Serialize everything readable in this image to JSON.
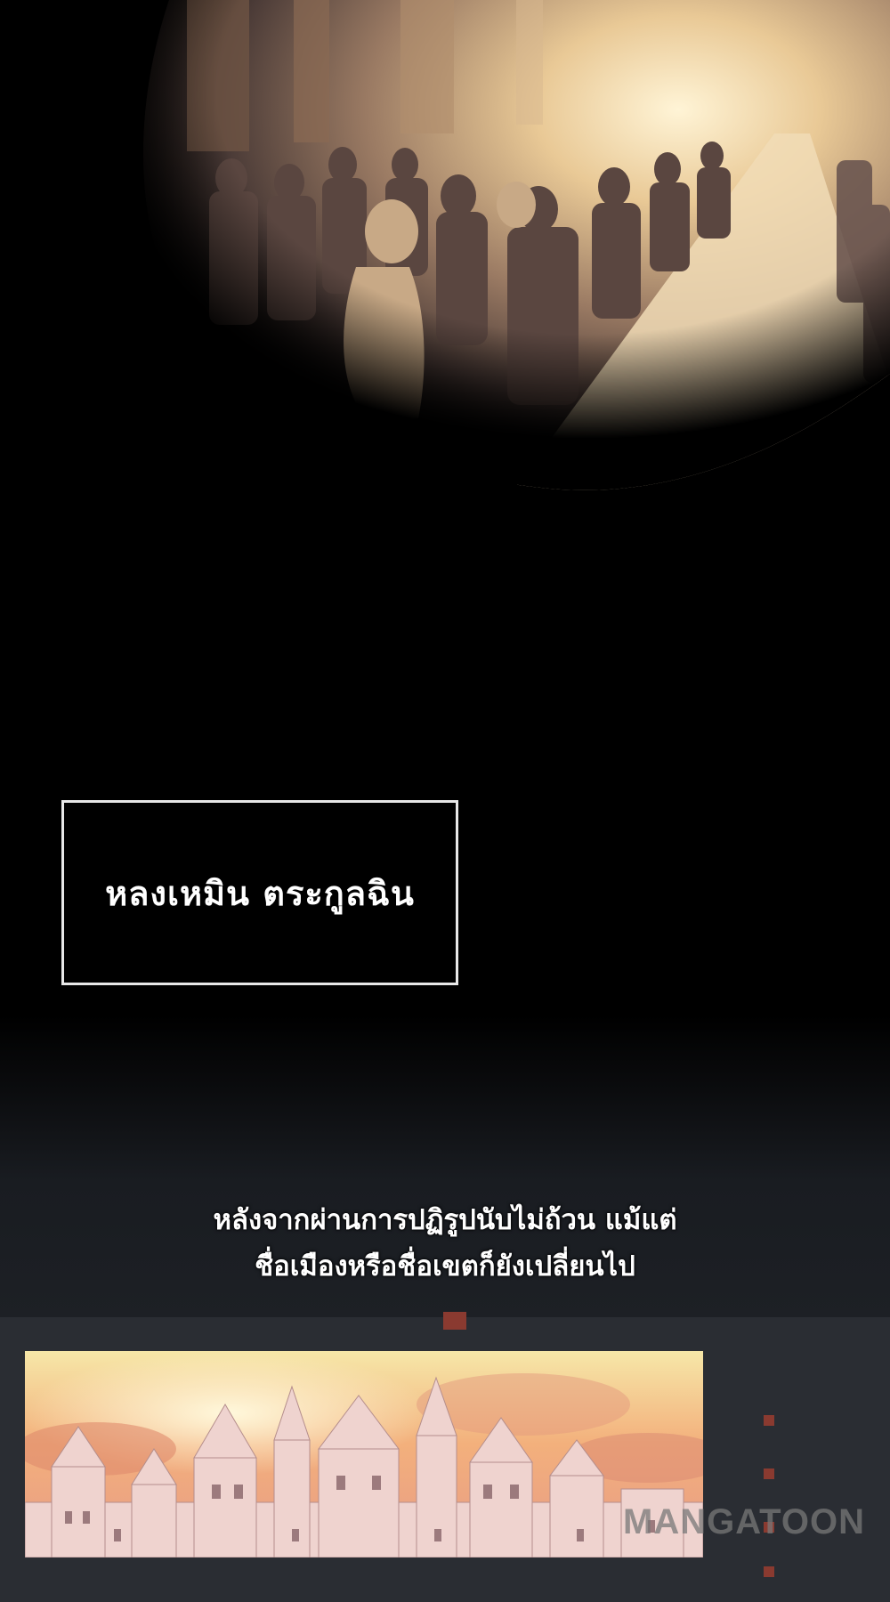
{
  "title_caption": "หลงเหมิน ตระกูลฉิน",
  "narration": {
    "line1": "หลังจากผ่านการปฏิรูปนับไม่ถ้วน แม้แต่",
    "line2": "ชื่อเมืองหรือชื่อเขตก็ยังเปลี่ยนไป"
  },
  "watermark": "MANGATOON",
  "colors": {
    "background": "#000000",
    "banquet_tone": "#c9a878",
    "sky_tone": "#f2b879",
    "caption_border": "#e8e8e8"
  }
}
